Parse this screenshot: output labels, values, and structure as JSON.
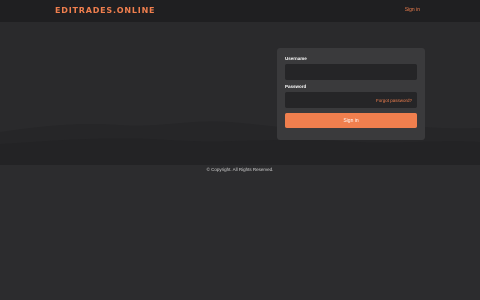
{
  "header": {
    "brand": "EDITRADES.ONLINE",
    "signin_link": "Sign in"
  },
  "login": {
    "username_label": "Username",
    "username_value": "",
    "password_label": "Password",
    "password_value": "",
    "forgot_link": "Forgot password?",
    "submit_label": "Sign in"
  },
  "footer": {
    "copyright": "© Copyright. All Rights Reserved."
  },
  "colors": {
    "accent": "#f07f4e",
    "topbar": "#1f1f21",
    "card": "#3a3a3c"
  }
}
